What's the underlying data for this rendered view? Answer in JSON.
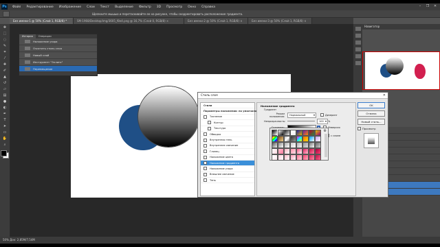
{
  "menubar": {
    "logo": "Ps",
    "items": [
      "Файл",
      "Редактирование",
      "Изображение",
      "Слои",
      "Текст",
      "Выделение",
      "Фильтр",
      "3D",
      "Просмотр",
      "Окно",
      "Справка"
    ],
    "window_controls": [
      "–",
      "❐",
      "✕"
    ]
  },
  "optionsbar": {
    "hint": "Щелкните мышью и перетаскивайте ее на рисунке, чтобы скорректировать расположение градиента."
  },
  "tabs": [
    {
      "label": "Без имени-1 @ 50% (Слой 1, RGB/8) *",
      "active": true
    },
    {
      "label": "SM-1968/Desktop/img/3605_f8e4.png @ 16,7% (Слой 0, RGB/8) ×",
      "active": false
    },
    {
      "label": "Без имени-2 @ 50% (Слой 1, RGB/8) ×",
      "active": false
    },
    {
      "label": "Без имени-3 @ 50% (Слой 1, RGB/8) ×",
      "active": false
    }
  ],
  "history": {
    "tabs": [
      "История",
      "Операции"
    ],
    "items": [
      {
        "label": "Наложение узора"
      },
      {
        "label": "Очистить стиль слоя"
      },
      {
        "label": "Новый слой"
      },
      {
        "label": "Инструмент \"Эллипс\""
      },
      {
        "label": "Перемещение",
        "selected": true
      }
    ]
  },
  "navigator": {
    "label": "Навигатор"
  },
  "status": {
    "zoom_doc": "50%  Док: 2,85М/7,54М"
  },
  "layer_style": {
    "title": "Стиль слоя",
    "close": "✕",
    "styles_list": [
      {
        "label": "Стили",
        "head": true
      },
      {
        "label": "Параметры наложения: по умолчанию",
        "head": true
      },
      {
        "label": "Тиснение"
      },
      {
        "label": "Контур",
        "indent": true
      },
      {
        "label": "Текстура",
        "indent": true
      },
      {
        "label": "Обводка"
      },
      {
        "label": "Внутренняя тень"
      },
      {
        "label": "Внутреннее свечение"
      },
      {
        "label": "Глянец"
      },
      {
        "label": "Наложение цвета"
      },
      {
        "label": "Наложение градиента",
        "selected": true
      },
      {
        "label": "Наложение узора"
      },
      {
        "label": "Внешнее свечение"
      },
      {
        "label": "Тень"
      }
    ],
    "group_title": "Наложение градиента",
    "group_sub": "Градиент",
    "blend_label": "Режим наложения:",
    "blend_value": "Нормальный",
    "dither_label": "Дизеринг",
    "opacity_label": "Непрозрачность:",
    "opacity_value": "100",
    "gradient_label": "Градиент:",
    "inverse_label": "Инверсия",
    "align_label": "с слоем",
    "percent_unit": "%",
    "buttons": {
      "ok": "OK",
      "cancel": "Отмена",
      "new_style": "Новый стиль...",
      "preview": "Просмотр"
    }
  },
  "gradient_picker": {
    "gear": "⚙"
  }
}
